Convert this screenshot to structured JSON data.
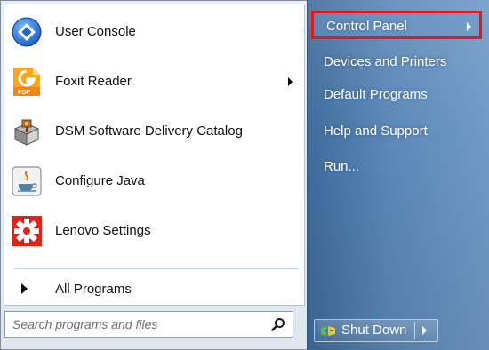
{
  "left": {
    "programs": [
      {
        "label": "User Console",
        "icon": "user-console-icon",
        "has_submenu": false
      },
      {
        "label": "Foxit Reader",
        "icon": "foxit-reader-icon",
        "has_submenu": true
      },
      {
        "label": "DSM Software Delivery Catalog",
        "icon": "dsm-catalog-icon",
        "has_submenu": false
      },
      {
        "label": "Configure Java",
        "icon": "java-icon",
        "has_submenu": false
      },
      {
        "label": "Lenovo Settings",
        "icon": "lenovo-settings-icon",
        "has_submenu": false
      }
    ],
    "all_programs_label": "All Programs",
    "search_placeholder": "Search programs and files"
  },
  "right": {
    "items": [
      {
        "label": "Control Panel",
        "highlighted": true,
        "has_submenu": true
      },
      {
        "label": "Devices and Printers"
      },
      {
        "label": "Default Programs"
      },
      {
        "label": "Help and Support"
      },
      {
        "label": "Run..."
      }
    ],
    "shutdown_label": "Shut Down"
  },
  "colors": {
    "highlight_border": "#e01b1b",
    "right_pane": "#5b88b8"
  }
}
